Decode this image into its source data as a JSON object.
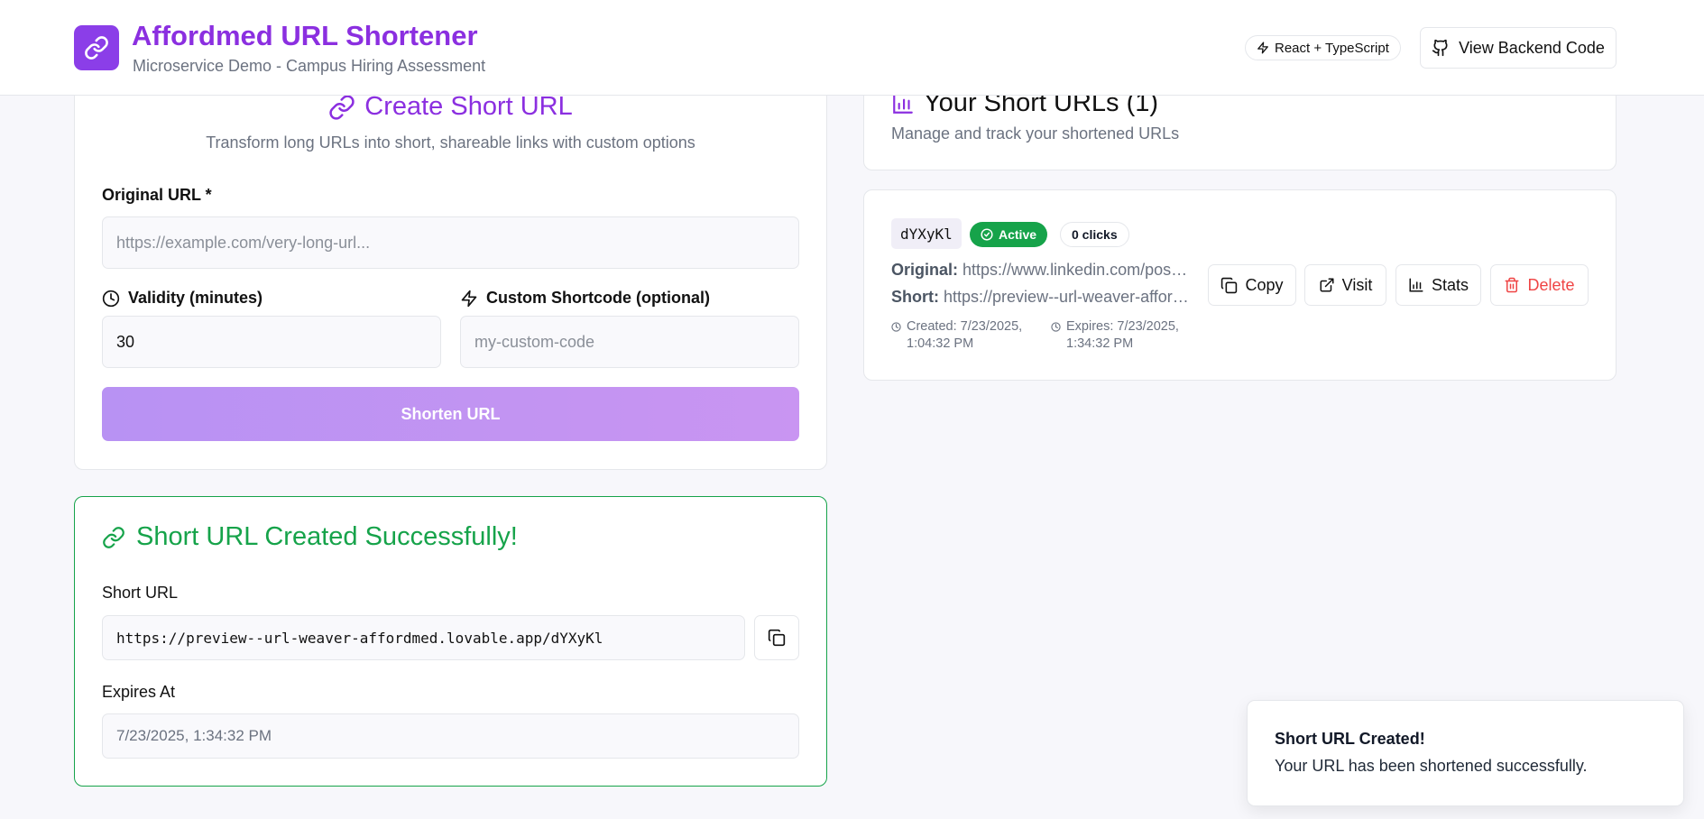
{
  "header": {
    "title": "Affordmed URL Shortener",
    "subtitle": "Microservice Demo - Campus Hiring Assessment",
    "tech_badge": "React + TypeScript",
    "backend_button": "View Backend Code",
    "logo_icon": "link-icon",
    "accent_color": "#8b2fe0"
  },
  "create": {
    "title": "Create Short URL",
    "description": "Transform long URLs into short, shareable links with custom options",
    "original_url_label": "Original URL *",
    "original_url_placeholder": "https://example.com/very-long-url...",
    "original_url_value": "",
    "validity_label": "Validity (minutes)",
    "validity_value": "30",
    "shortcode_label": "Custom Shortcode (optional)",
    "shortcode_placeholder": "my-custom-code",
    "shortcode_value": "",
    "submit_label": "Shorten URL"
  },
  "success": {
    "title": "Short URL Created Successfully!",
    "short_url_label": "Short URL",
    "short_url_value": "https://preview--url-weaver-affordmed.lovable.app/dYXyKl",
    "expires_label": "Expires At",
    "expires_value": "7/23/2025, 1:34:32 PM",
    "success_color": "#16a34a"
  },
  "list": {
    "title": "Your Short URLs (1)",
    "description": "Manage and track your shortened URLs",
    "items": [
      {
        "code": "dYXyKl",
        "status": "Active",
        "clicks": "0 clicks",
        "original_label": "Original:",
        "original_value": "https://www.linkedin.com/posts/...",
        "short_label": "Short:",
        "short_value": "https://preview--url-weaver-affordmed.lovable.app/dYXyKl",
        "created_line1": "Created: 7/23/2025,",
        "created_line2": "1:04:32 PM",
        "expires_line1": "Expires: 7/23/2025,",
        "expires_line2": "1:34:32 PM",
        "copy_label": "Copy",
        "visit_label": "Visit",
        "stats_label": "Stats",
        "delete_label": "Delete"
      }
    ]
  },
  "toast": {
    "title": "Short URL Created!",
    "description": "Your URL has been shortened successfully."
  }
}
